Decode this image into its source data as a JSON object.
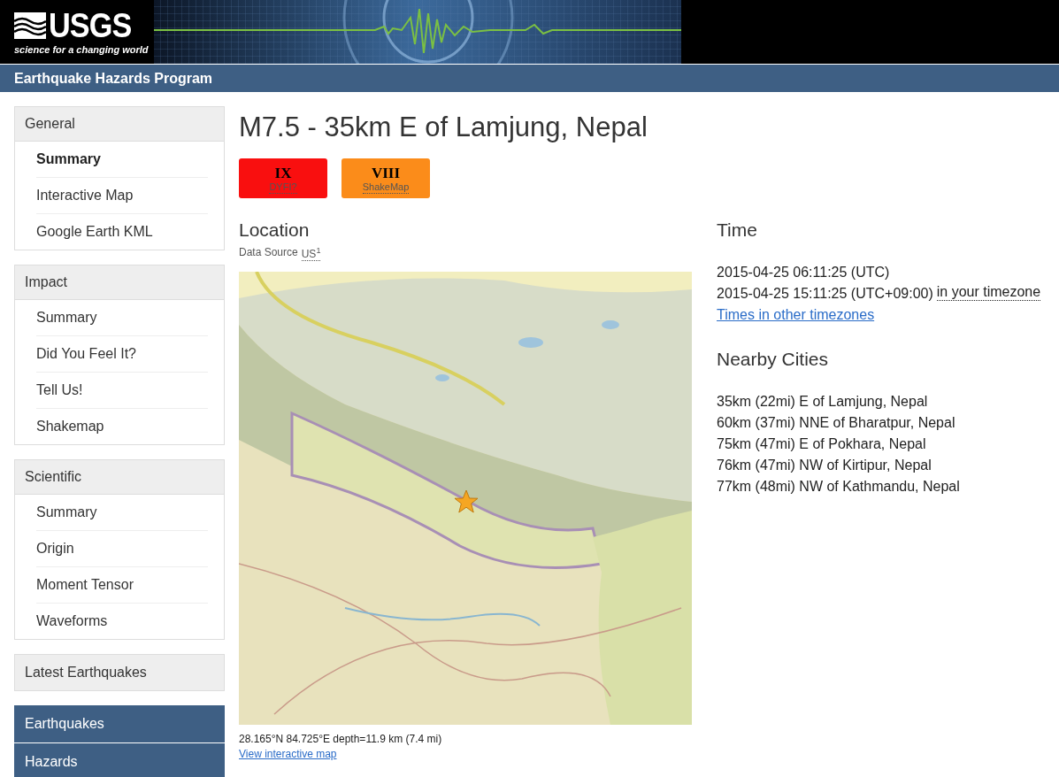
{
  "header": {
    "logo": "USGS",
    "tagline": "science for a changing world",
    "program": "Earthquake Hazards Program"
  },
  "sidebar": {
    "groups": [
      {
        "title": "General",
        "items": [
          {
            "label": "Summary",
            "selected": true
          },
          {
            "label": "Interactive Map",
            "selected": false
          },
          {
            "label": "Google Earth KML",
            "selected": false
          }
        ]
      },
      {
        "title": "Impact",
        "items": [
          {
            "label": "Summary",
            "selected": false
          },
          {
            "label": "Did You Feel It?",
            "selected": false
          },
          {
            "label": "Tell Us!",
            "selected": false
          },
          {
            "label": "Shakemap",
            "selected": false
          }
        ]
      },
      {
        "title": "Scientific",
        "items": [
          {
            "label": "Summary",
            "selected": false
          },
          {
            "label": "Origin",
            "selected": false
          },
          {
            "label": "Moment Tensor",
            "selected": false
          },
          {
            "label": "Waveforms",
            "selected": false
          }
        ]
      }
    ],
    "latest": "Latest Earthquakes",
    "links": [
      "Earthquakes",
      "Hazards"
    ]
  },
  "event": {
    "title": "M7.5 - 35km E of Lamjung, Nepal",
    "badges": [
      {
        "value": "IX",
        "label": "DYFI?",
        "color": "#f90f0f"
      },
      {
        "value": "VIII",
        "label": "ShakeMap",
        "color": "#fb8c1a"
      }
    ],
    "location": {
      "heading": "Location",
      "source_label": "Data Source",
      "source": "US",
      "source_note": "1",
      "coordinates": "28.165°N 84.725°E depth=11.9 km (7.4 mi)",
      "map_link": "View interactive map"
    },
    "time": {
      "heading": "Time",
      "utc": "2015-04-25 06:11:25 (UTC)",
      "local": "2015-04-25 15:11:25 (UTC+09:00)",
      "local_note": "in your timezone",
      "other_link": "Times in other timezones"
    },
    "nearby": {
      "heading": "Nearby Cities",
      "cities": [
        "35km (22mi) E of Lamjung, Nepal",
        "60km (37mi) NNE of Bharatpur, Nepal",
        "75km (47mi) E of Pokhara, Nepal",
        "76km (47mi) NW of Kirtipur, Nepal",
        "77km (48mi) NW of Kathmandu, Nepal"
      ]
    }
  }
}
